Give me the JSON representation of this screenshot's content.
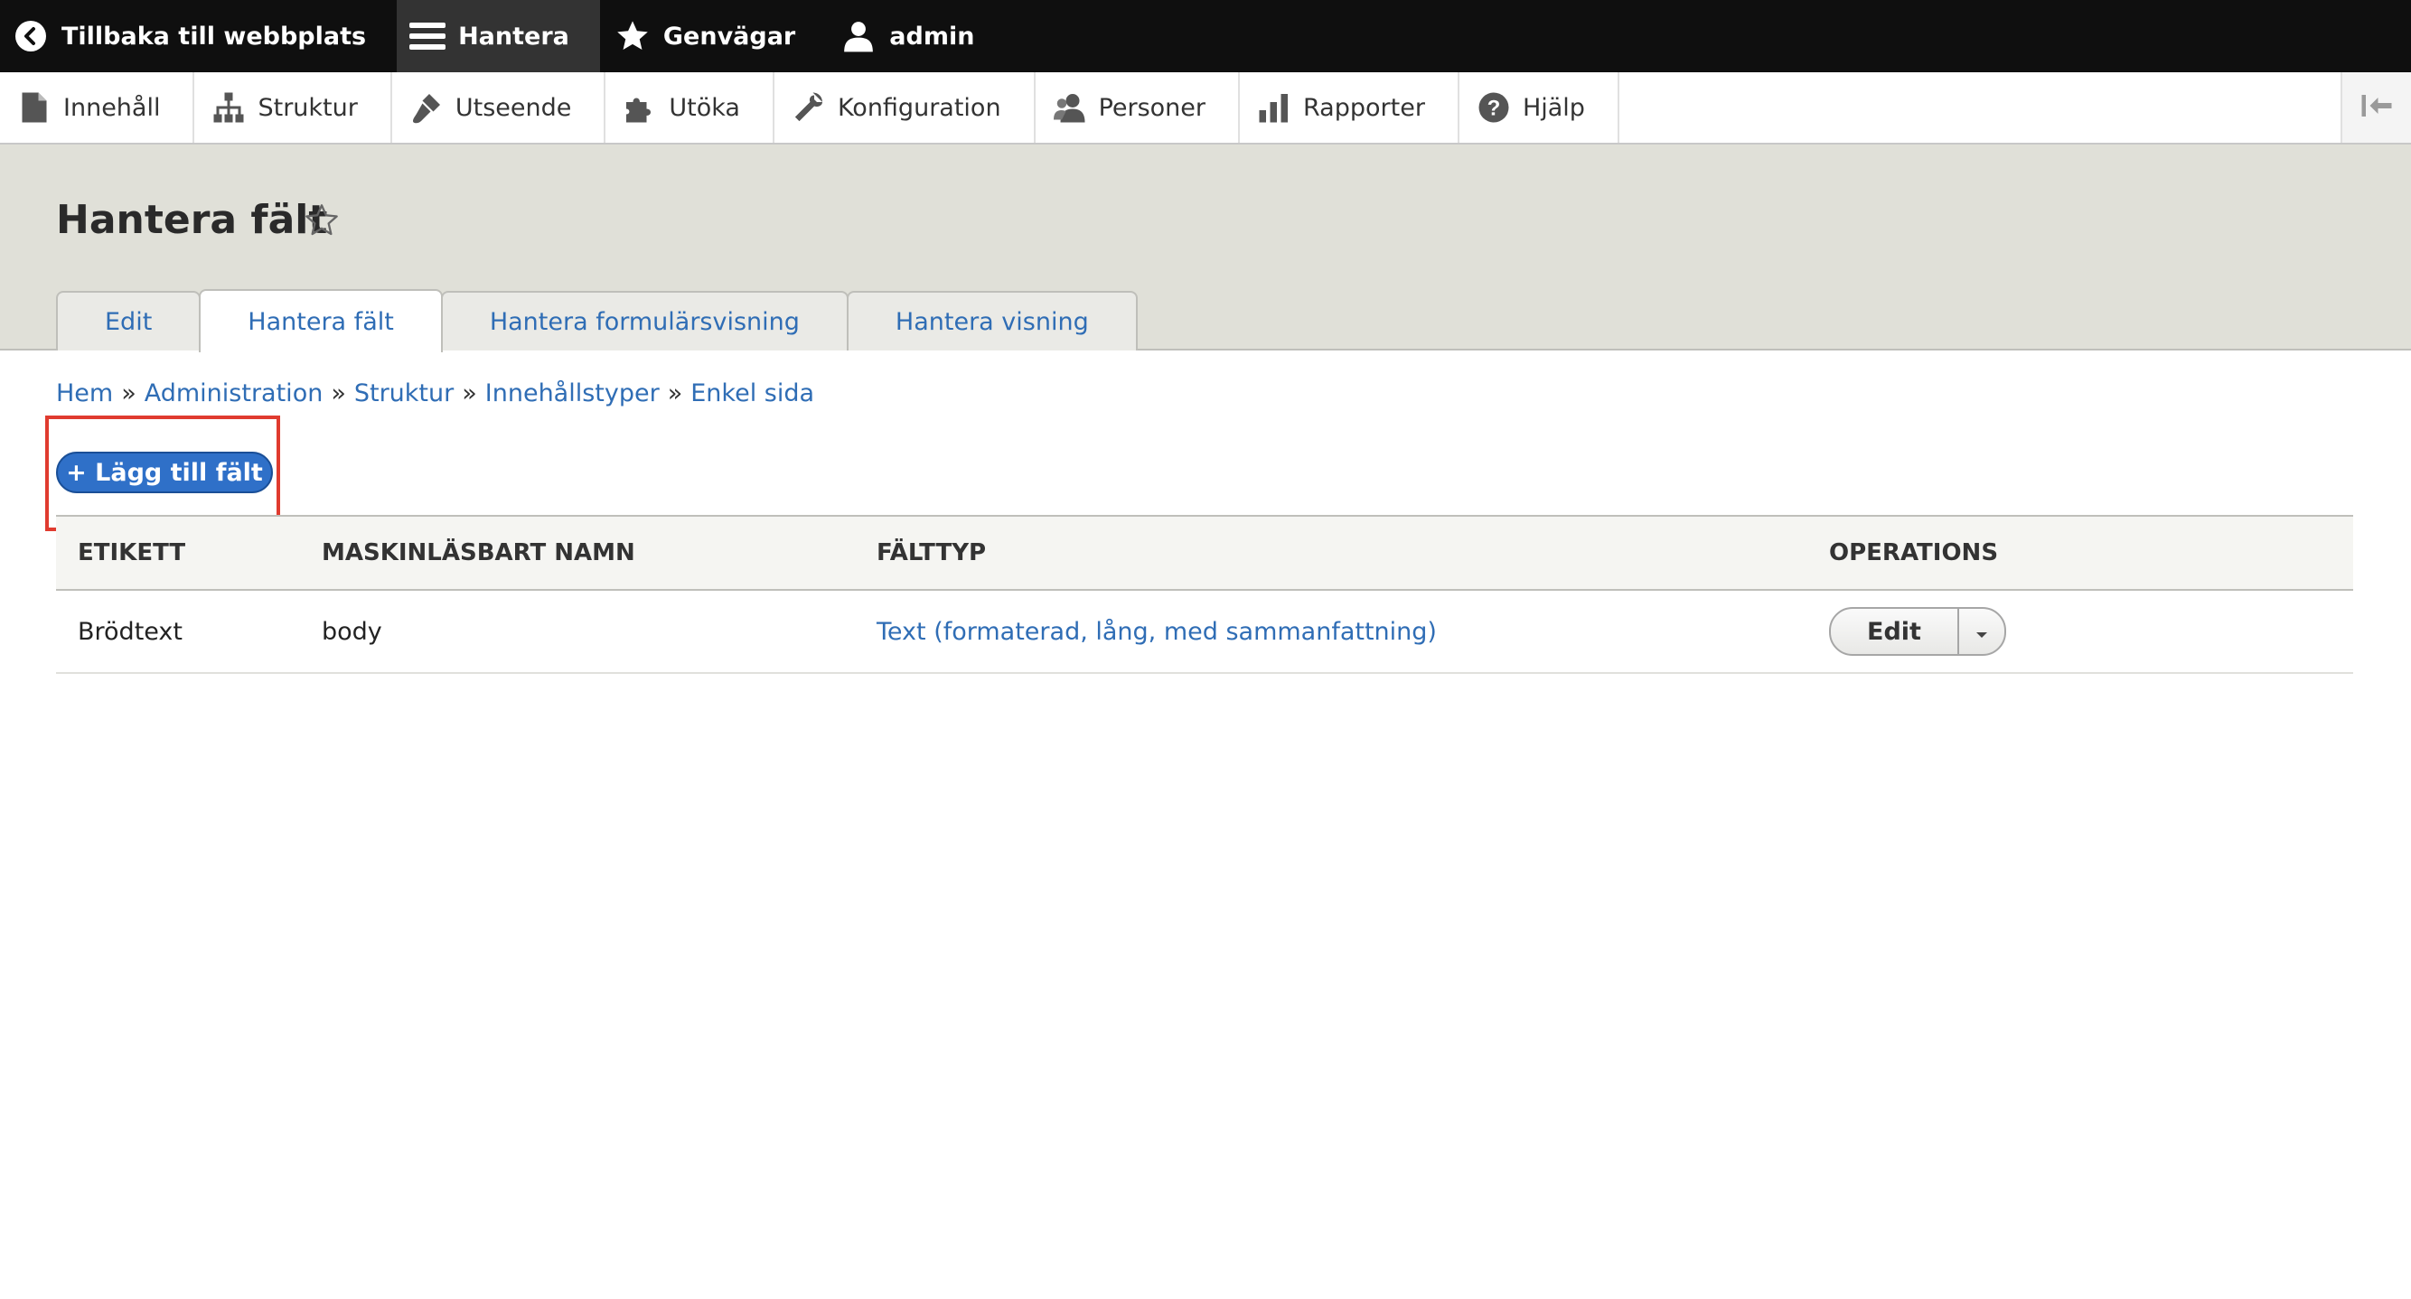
{
  "toolbar": {
    "back_label": "Tillbaka till webbplats",
    "manage_label": "Hantera",
    "shortcuts_label": "Genvägar",
    "user_label": "admin"
  },
  "tray": {
    "items": [
      {
        "label": "Innehåll",
        "icon": "file-icon"
      },
      {
        "label": "Struktur",
        "icon": "sitemap-icon"
      },
      {
        "label": "Utseende",
        "icon": "paintbrush-icon"
      },
      {
        "label": "Utöka",
        "icon": "puzzle-icon"
      },
      {
        "label": "Konfiguration",
        "icon": "wrench-icon"
      },
      {
        "label": "Personer",
        "icon": "people-icon"
      },
      {
        "label": "Rapporter",
        "icon": "bar-chart-icon"
      },
      {
        "label": "Hjälp",
        "icon": "help-icon"
      }
    ]
  },
  "page": {
    "title": "Hantera fält"
  },
  "tabs": [
    {
      "label": "Edit"
    },
    {
      "label": "Hantera fält"
    },
    {
      "label": "Hantera formulärsvisning"
    },
    {
      "label": "Hantera visning"
    }
  ],
  "breadcrumb": [
    {
      "label": "Hem"
    },
    {
      "label": "Administration"
    },
    {
      "label": "Struktur"
    },
    {
      "label": "Innehållstyper"
    },
    {
      "label": "Enkel sida"
    }
  ],
  "breadcrumb_separator": "»",
  "add_field_button": "+ Lägg till fält",
  "table": {
    "headers": {
      "label": "ETIKETT",
      "machine_name": "MASKINLÄSBART NAMN",
      "field_type": "FÄLTTYP",
      "operations": "OPERATIONS"
    },
    "rows": [
      {
        "label": "Brödtext",
        "machine_name": "body",
        "field_type": "Text (formaterad, lång, med sammanfattning)",
        "operation": "Edit"
      }
    ]
  },
  "colors": {
    "toolbar_bg": "#0f0f0f",
    "header_bg": "#e0e0d8",
    "link": "#2f6db5",
    "primary_button": "#2f70c8",
    "highlight": "#e03b2f"
  }
}
